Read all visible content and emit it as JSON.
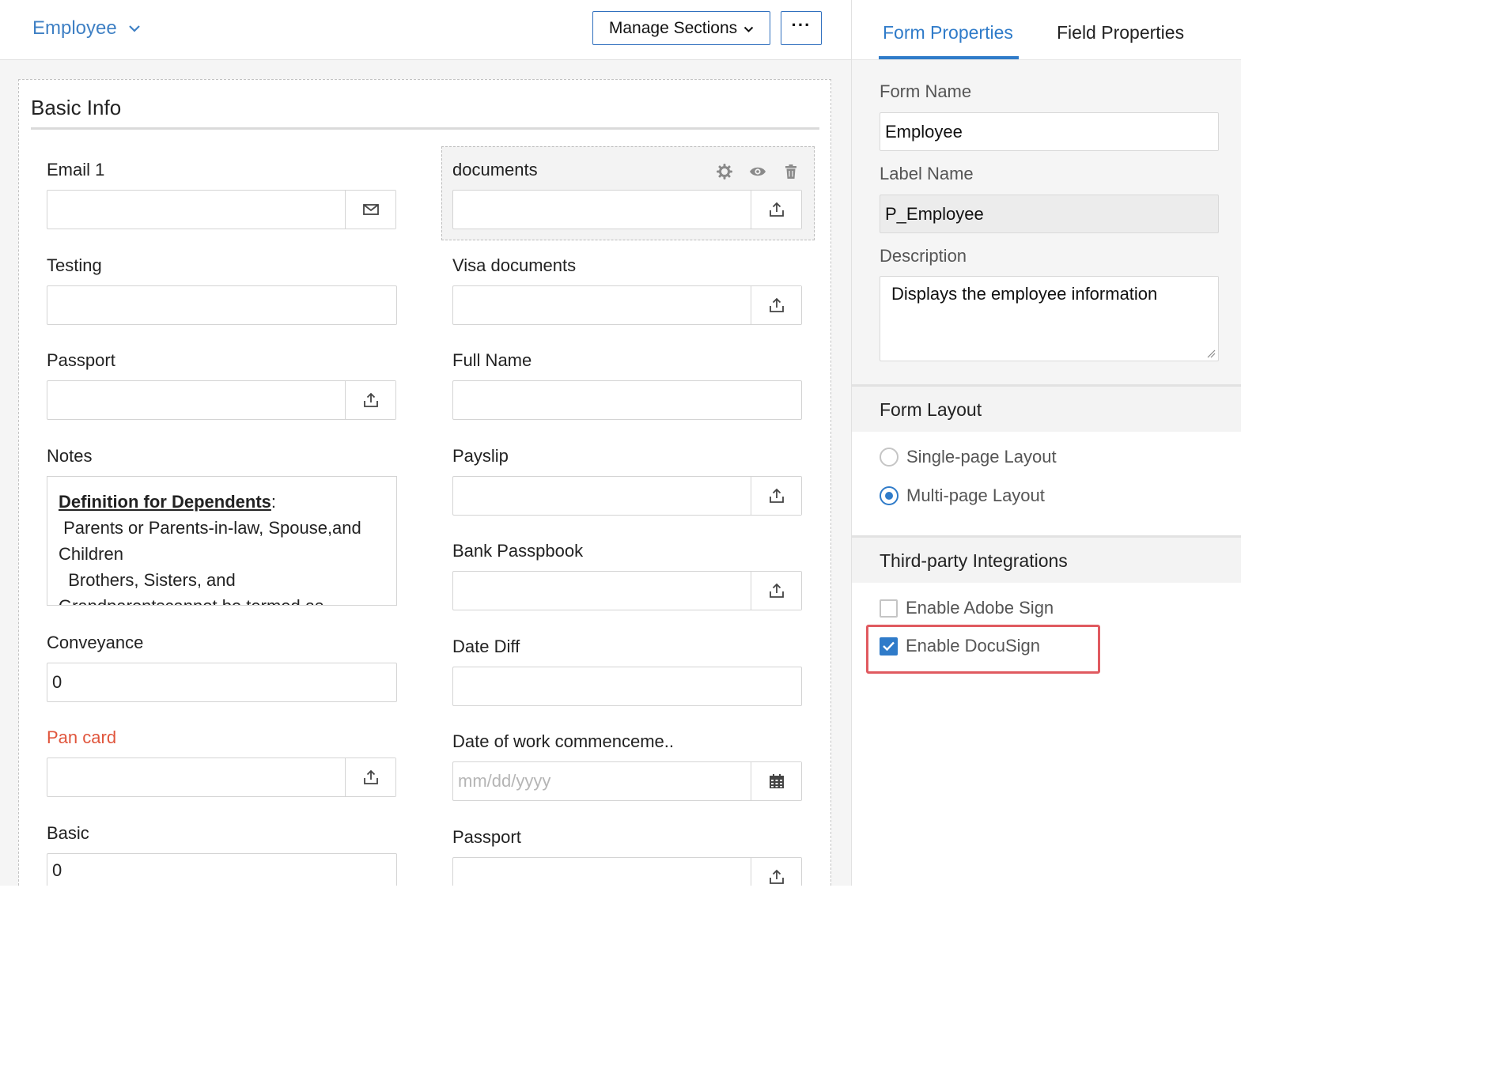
{
  "header": {
    "form_selector": "Employee",
    "manage_sections_label": "Manage Sections",
    "more_label": "···"
  },
  "section": {
    "title": "Basic Info"
  },
  "fields_left": [
    {
      "label": "Email 1",
      "value": "",
      "addon_icon": "mail-icon"
    },
    {
      "label": "Testing",
      "value": ""
    },
    {
      "label": "Passport",
      "value": "",
      "addon_icon": "upload-icon"
    },
    {
      "label": "Notes"
    },
    {
      "label": "Conveyance",
      "value": "0"
    },
    {
      "label": "Pan card",
      "value": "",
      "addon_icon": "upload-icon",
      "mandatory": true
    },
    {
      "label": "Basic",
      "value": "0"
    }
  ],
  "notes_content": {
    "definition_label": "Definition for Dependents",
    "line1": " Parents or Parents-in-law, Spouse,and",
    "line2": "Children",
    "line3": "  Brothers, Sisters, and",
    "line4": "Grandparentscannot be termed as"
  },
  "fields_right": [
    {
      "label": "documents",
      "value": "",
      "addon_icon": "upload-icon",
      "selected": true
    },
    {
      "label": "Visa documents",
      "value": "",
      "addon_icon": "upload-icon"
    },
    {
      "label": "Full Name",
      "value": ""
    },
    {
      "label": "Payslip",
      "value": "",
      "addon_icon": "upload-icon"
    },
    {
      "label": "Bank Passpbook",
      "value": "",
      "addon_icon": "upload-icon"
    },
    {
      "label": "Date Diff",
      "value": ""
    },
    {
      "label": "Date of work commenceme..",
      "placeholder": "mm/dd/yyyy",
      "addon_icon": "calendar-icon"
    },
    {
      "label": "Passport",
      "value": "",
      "addon_icon": "upload-icon"
    }
  ],
  "selected_field_tools": [
    "settings-icon",
    "eye-icon",
    "trash-icon"
  ],
  "panel": {
    "tabs": [
      {
        "label": "Form Properties",
        "active": true
      },
      {
        "label": "Field Properties",
        "active": false
      }
    ],
    "form_name_label": "Form Name",
    "form_name_value": "Employee",
    "label_name_label": "Label Name",
    "label_name_value": "P_Employee",
    "description_label": "Description",
    "description_value": "Displays the employee information",
    "layout_heading": "Form Layout",
    "layout_options": [
      {
        "label": "Single-page Layout",
        "selected": false
      },
      {
        "label": "Multi-page Layout",
        "selected": true
      }
    ],
    "integrations_heading": "Third-party Integrations",
    "integrations": [
      {
        "label": "Enable Adobe Sign",
        "checked": false
      },
      {
        "label": "Enable DocuSign",
        "checked": true
      }
    ]
  },
  "colors": {
    "accent": "#2f7bc9",
    "mandatory_label": "#e0553c",
    "highlight_box": "#e05a60"
  }
}
